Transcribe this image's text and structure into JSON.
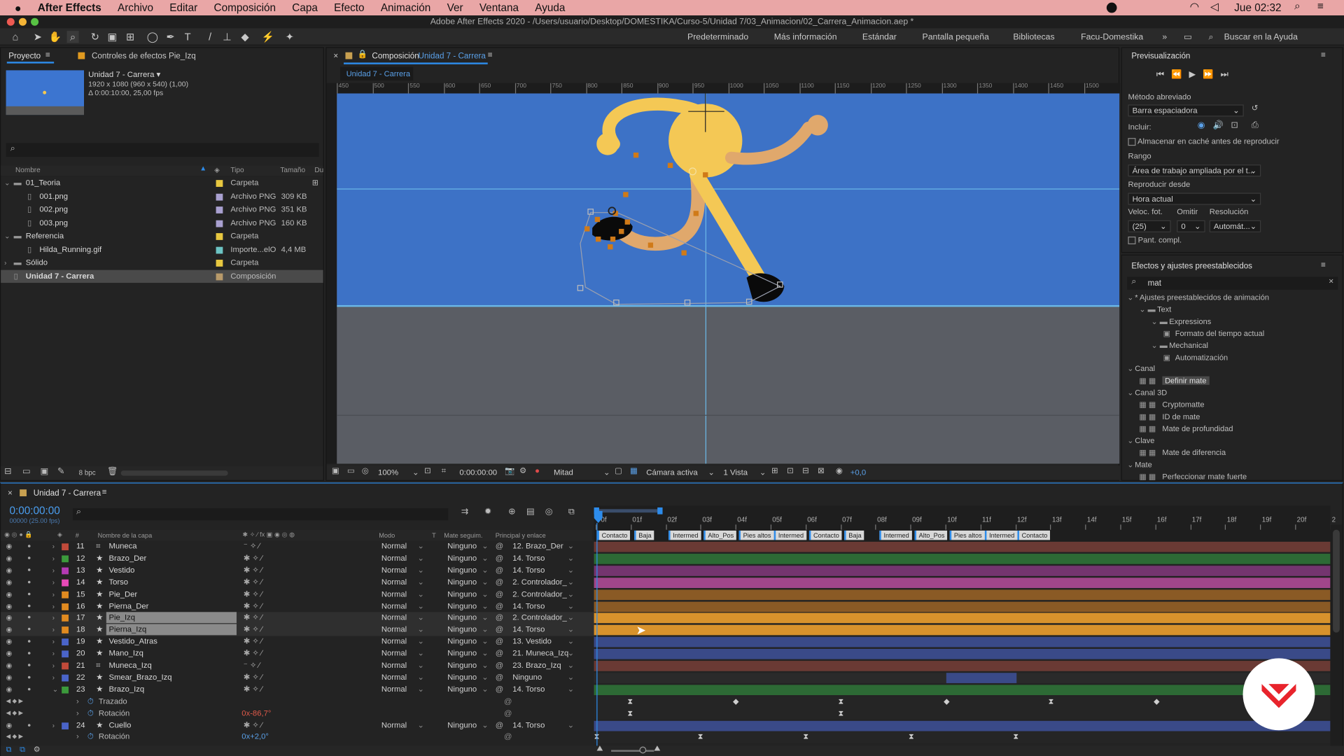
{
  "mac_menu": {
    "app": "After Effects",
    "items": [
      "Archivo",
      "Editar",
      "Composición",
      "Capa",
      "Efecto",
      "Animación",
      "Ver",
      "Ventana",
      "Ayuda"
    ],
    "clock": "Jue 02:32"
  },
  "window_title": "Adobe After Effects 2020 - /Users/usuario/Desktop/DOMESTIKA/Curso-5/Unidad 7/03_Animacion/02_Carrera_Animacion.aep *",
  "workspaces": [
    "Predeterminado",
    "Más información",
    "Estándar",
    "Pantalla pequeña",
    "Bibliotecas",
    "Facu-Domestika"
  ],
  "help_search": "Buscar en la Ayuda",
  "project": {
    "tab": "Proyecto",
    "tab2": "Controles de efectos Pie_Izq",
    "comp_name": "Unidad 7 - Carrera ▾",
    "comp_size": "1920 x 1080  (960 x 540) (1,00)",
    "comp_dur": "Δ 0:00:10:00, 25,00 fps",
    "search_icon": "search-icon",
    "headers": {
      "name": "Nombre",
      "type": "Tipo",
      "size": "Tamaño",
      "dur": "Du"
    },
    "rows": [
      {
        "name": "01_Teoria",
        "type": "Carpeta",
        "size": "",
        "color": "#e8c840",
        "indent": 0,
        "folder": true,
        "open": true
      },
      {
        "name": "001.png",
        "type": "Archivo PNG",
        "size": "309 KB",
        "color": "#a9a0d0",
        "indent": 2,
        "folder": false
      },
      {
        "name": "002.png",
        "type": "Archivo PNG",
        "size": "351 KB",
        "color": "#a9a0d0",
        "indent": 2,
        "folder": false
      },
      {
        "name": "003.png",
        "type": "Archivo PNG",
        "size": "160 KB",
        "color": "#a9a0d0",
        "indent": 2,
        "folder": false
      },
      {
        "name": "Referencia",
        "type": "Carpeta",
        "size": "",
        "color": "#e8c840",
        "indent": 0,
        "folder": true,
        "open": true
      },
      {
        "name": "Hilda_Running.gif",
        "type": "Importe...elO",
        "size": "4,4 MB",
        "color": "#6cc4c4",
        "indent": 2,
        "folder": false
      },
      {
        "name": "Sólido",
        "type": "Carpeta",
        "size": "",
        "color": "#e8c840",
        "indent": 0,
        "folder": true,
        "open": false
      },
      {
        "name": "Unidad 7 - Carrera",
        "type": "Composición",
        "size": "",
        "color": "#b89a6a",
        "indent": 0,
        "folder": false,
        "selected": true
      }
    ],
    "bpc": "8 bpc"
  },
  "comp": {
    "tab_label": "Composición",
    "comp_link": "Unidad 7 - Carrera",
    "sub_tab": "Unidad 7 - Carrera",
    "ruler_labels": [
      "450",
      "500",
      "550",
      "600",
      "650",
      "700",
      "750",
      "800",
      "850",
      "900",
      "950",
      "1000",
      "1050",
      "1100",
      "1150",
      "1200",
      "1250",
      "1300",
      "1350",
      "1400",
      "1450",
      "1500"
    ],
    "zoom": "100%",
    "time": "0:00:00:00",
    "resolution": "Mitad",
    "camera": "Cámara activa",
    "views": "1 Vista",
    "exposure": "+0,0"
  },
  "preview": {
    "title": "Previsualización",
    "method_label": "Método abreviado",
    "method": "Barra espaciadora",
    "include": "Incluir:",
    "cache": "Almacenar en caché antes de reproducir",
    "range_label": "Rango",
    "range": "Área de trabajo ampliada por el t...",
    "play_from_label": "Reproducir desde",
    "play_from": "Hora actual",
    "fps_label": "Veloc. fot.",
    "skip_label": "Omitir",
    "res_label": "Resolución",
    "fps": "(25)",
    "skip": "0",
    "res": "Automát...",
    "fullscreen": "Pant. compl."
  },
  "effects": {
    "title": "Efectos y ajustes preestablecidos",
    "search": "mat",
    "tree": [
      {
        "t": "* Ajustes preestablecidos de animación",
        "lvl": 0,
        "k": "cat"
      },
      {
        "t": "Text",
        "lvl": 1,
        "k": "folder"
      },
      {
        "t": "Expressions",
        "lvl": 2,
        "k": "folder"
      },
      {
        "t": "Formato del tiempo actual",
        "lvl": 3,
        "k": "item"
      },
      {
        "t": "Mechanical",
        "lvl": 2,
        "k": "folder"
      },
      {
        "t": "Automatización",
        "lvl": 3,
        "k": "item"
      },
      {
        "t": "Canal",
        "lvl": 0,
        "k": "cat"
      },
      {
        "t": "Definir mate",
        "lvl": 1,
        "k": "fx",
        "sel": true
      },
      {
        "t": "Canal 3D",
        "lvl": 0,
        "k": "cat"
      },
      {
        "t": "Cryptomatte",
        "lvl": 1,
        "k": "fx"
      },
      {
        "t": "ID de mate",
        "lvl": 1,
        "k": "fx"
      },
      {
        "t": "Mate de profundidad",
        "lvl": 1,
        "k": "fx"
      },
      {
        "t": "Clave",
        "lvl": 0,
        "k": "cat"
      },
      {
        "t": "Mate de diferencia",
        "lvl": 1,
        "k": "fx"
      },
      {
        "t": "Mate",
        "lvl": 0,
        "k": "cat"
      },
      {
        "t": "Perfeccionar mate fuerte",
        "lvl": 1,
        "k": "fx"
      }
    ]
  },
  "timeline": {
    "tab": "Unidad 7 - Carrera",
    "timecode": "0:00:00:00",
    "frame_info": "00000 (25.00 fps)",
    "headers": {
      "num": "#",
      "name": "Nombre de la capa",
      "mode": "Modo",
      "t": "T",
      "mate": "Mate seguim.",
      "parent": "Principal y enlace"
    },
    "ruler": [
      "0f",
      "01f",
      "02f",
      "03f",
      "04f",
      "05f",
      "06f",
      "07f",
      "08f",
      "09f",
      "10f",
      "11f",
      "12f",
      "13f",
      "14f",
      "15f",
      "16f",
      "17f",
      "18f",
      "19f",
      "20f",
      "2"
    ],
    "markers": [
      "Contacto",
      "Baja",
      "Intermed",
      "Alto_Pos",
      "Pies altos",
      "Intermed",
      "Contacto",
      "Baja",
      "Intermed",
      "Alto_Pos",
      "Pies altos",
      "Intermed",
      "Contacto"
    ],
    "layers": [
      {
        "n": "11",
        "name": "Muneca",
        "mode": "Normal",
        "mate": "Ninguno",
        "parent": "12. Brazo_Der",
        "color": "#c04a3a",
        "bar": "#6a3a34",
        "null": true
      },
      {
        "n": "12",
        "name": "Brazo_Der",
        "mode": "Normal",
        "mate": "Ninguno",
        "parent": "14. Torso",
        "color": "#3c9a3c",
        "bar": "#2d6a35"
      },
      {
        "n": "13",
        "name": "Vestido",
        "mode": "Normal",
        "mate": "Ninguno",
        "parent": "14. Torso",
        "color": "#b43ab4",
        "bar": "#74356f"
      },
      {
        "n": "14",
        "name": "Torso",
        "mode": "Normal",
        "mate": "Ninguno",
        "parent": "2. Controlador_",
        "color": "#e84ab8",
        "bar": "#a0468a"
      },
      {
        "n": "15",
        "name": "Pie_Der",
        "mode": "Normal",
        "mate": "Ninguno",
        "parent": "2. Controlador_",
        "color": "#e08a20",
        "bar": "#8a5a25"
      },
      {
        "n": "16",
        "name": "Pierna_Der",
        "mode": "Normal",
        "mate": "Ninguno",
        "parent": "14. Torso",
        "color": "#e08a20",
        "bar": "#8a5a25"
      },
      {
        "n": "17",
        "name": "Pie_Izq",
        "mode": "Normal",
        "mate": "Ninguno",
        "parent": "2. Controlador_",
        "color": "#e08a20",
        "bar": "#d8922c",
        "sel": true
      },
      {
        "n": "18",
        "name": "Pierna_Izq",
        "mode": "Normal",
        "mate": "Ninguno",
        "parent": "14. Torso",
        "color": "#e08a20",
        "bar": "#d8922c",
        "sel": true
      },
      {
        "n": "19",
        "name": "Vestido_Atras",
        "mode": "Normal",
        "mate": "Ninguno",
        "parent": "13. Vestido",
        "color": "#4a64c8",
        "bar": "#3a4a88"
      },
      {
        "n": "20",
        "name": "Mano_Izq",
        "mode": "Normal",
        "mate": "Ninguno",
        "parent": "21. Muneca_Izq",
        "color": "#4a64c8",
        "bar": "#3a4a88"
      },
      {
        "n": "21",
        "name": "Muneca_Izq",
        "mode": "Normal",
        "mate": "Ninguno",
        "parent": "23. Brazo_Izq",
        "color": "#c04a3a",
        "bar": "#6a3a34",
        "null": true
      },
      {
        "n": "22",
        "name": "Smear_Brazo_Izq",
        "mode": "Normal",
        "mate": "Ninguno",
        "parent": "Ninguno",
        "color": "#4a64c8",
        "bar": "#2a2a2a"
      },
      {
        "n": "23",
        "name": "Brazo_Izq",
        "mode": "Normal",
        "mate": "Ninguno",
        "parent": "14. Torso",
        "color": "#3c9a3c",
        "bar": "#2d6a35",
        "open": true
      }
    ],
    "sub_trazado": "Trazado",
    "sub_rot": "Rotación",
    "rot_val": "0x-86,7°",
    "cuello": {
      "n": "24",
      "name": "Cuello",
      "mode": "Normal",
      "mate": "Ninguno",
      "parent": "14. Torso",
      "color": "#4a64c8",
      "bar": "#3a4a88"
    },
    "cuello_rot": "Rotación",
    "cuello_rot_val": "0x+2,0°"
  },
  "accent": "#2d8ceb"
}
